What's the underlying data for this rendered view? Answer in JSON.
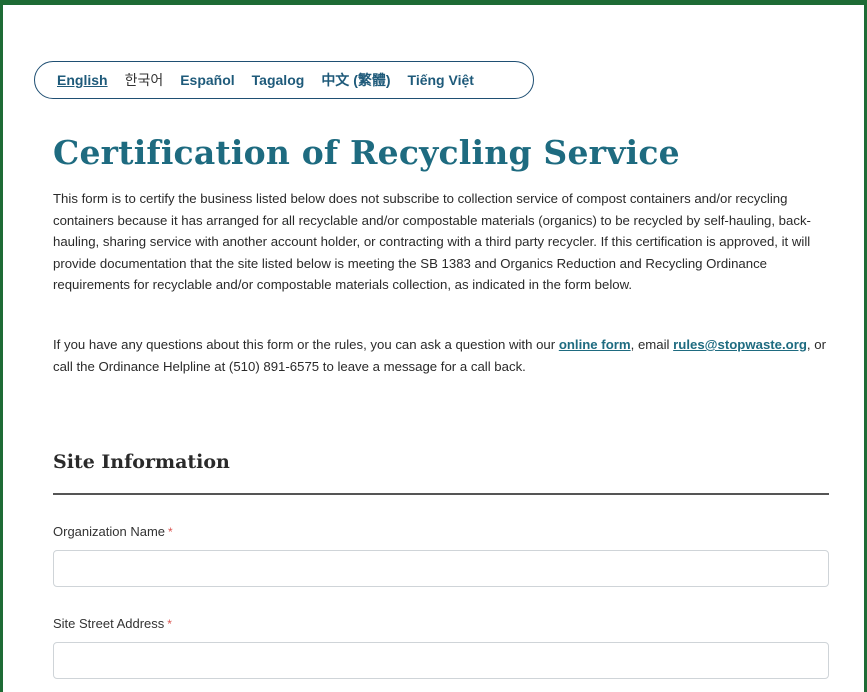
{
  "languages": [
    {
      "label": "English",
      "active": true
    },
    {
      "label": "한국어",
      "active": false
    },
    {
      "label": "Español",
      "active": false
    },
    {
      "label": "Tagalog",
      "active": false
    },
    {
      "label": "中文 (繁體)",
      "active": false
    },
    {
      "label": "Tiếng Việt",
      "active": false
    }
  ],
  "page": {
    "title": "Certification of Recycling Service",
    "intro": "This form is to certify the business listed below does not subscribe to collection service of compost containers and/or recycling containers because it has arranged for all recyclable and/or compostable materials (organics) to be recycled by self-hauling, back-hauling, sharing service with another account holder, or contracting with a third party recycler.  If this certification is approved, it will provide documentation that the site listed below is meeting the SB 1383 and Organics Reduction and Recycling Ordinance requirements for recyclable and/or compostable materials collection, as indicated in the form below.",
    "questions_prefix": "If you have any questions about this form or the rules, you can ask a question with our ",
    "online_form_link": "online form",
    "questions_mid": ", email ",
    "email_link": "rules@stopwaste.org",
    "questions_suffix": ", or call the Ordinance Helpline at (510) 891-6575 to leave a message for a call back."
  },
  "section": {
    "title": "Site Information"
  },
  "fields": {
    "organization_name": {
      "label": "Organization Name",
      "required_mark": "*",
      "value": ""
    },
    "site_street_address": {
      "label": "Site Street Address",
      "required_mark": "*",
      "value": ""
    }
  },
  "colors": {
    "brand_green": "#1e6b35",
    "title_teal": "#1e6b80",
    "link_blue": "#1e5a7a",
    "required_red": "#d9534f"
  }
}
